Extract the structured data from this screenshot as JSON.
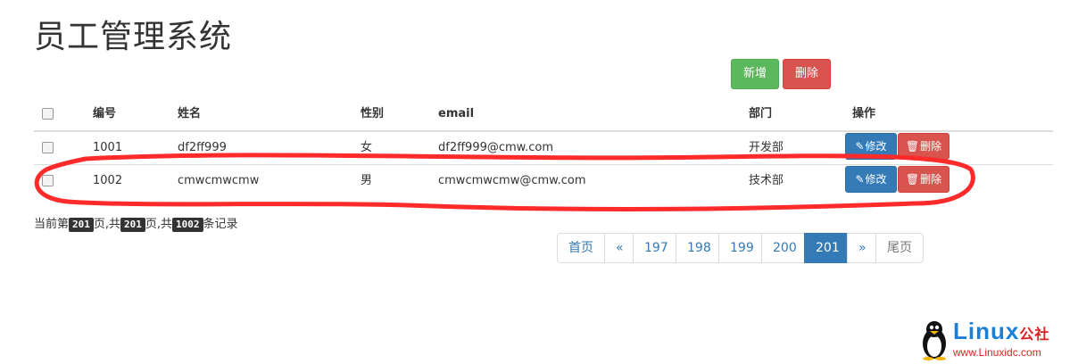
{
  "page": {
    "title": "员工管理系统"
  },
  "toolbar": {
    "add_label": "新增",
    "delete_label": "删除"
  },
  "table": {
    "headers": {
      "id": "编号",
      "name": "姓名",
      "gender": "性别",
      "email": "email",
      "dept": "部门",
      "ops": "操作"
    },
    "rows": [
      {
        "id": "1001",
        "name": "df2ff999",
        "gender": "女",
        "email": "df2ff999@cmw.com",
        "dept": "开发部",
        "edit": "修改",
        "delete": "删除"
      },
      {
        "id": "1002",
        "name": "cmwcmwcmw",
        "gender": "男",
        "email": "cmwcmwcmw@cmw.com",
        "dept": "技术部",
        "edit": "修改",
        "delete": "删除"
      }
    ]
  },
  "pageinfo": {
    "prefix": "当前第",
    "current": "201",
    "mid1": "页,共",
    "total_pages": "201",
    "mid2": "页,共",
    "total_records": "1002",
    "suffix": "条记录"
  },
  "pagination": {
    "first": "首页",
    "prev": "«",
    "pages": [
      "197",
      "198",
      "199",
      "200",
      "201"
    ],
    "active_page": "201",
    "next": "»",
    "last": "尾页"
  },
  "watermark": {
    "brand": "Linux",
    "brand_suffix": "公社",
    "url": "www.Linuxidc.com"
  },
  "colors": {
    "success": "#5cb85c",
    "danger": "#d9534f",
    "primary": "#337ab7",
    "annotation": "#ff2a2a"
  }
}
